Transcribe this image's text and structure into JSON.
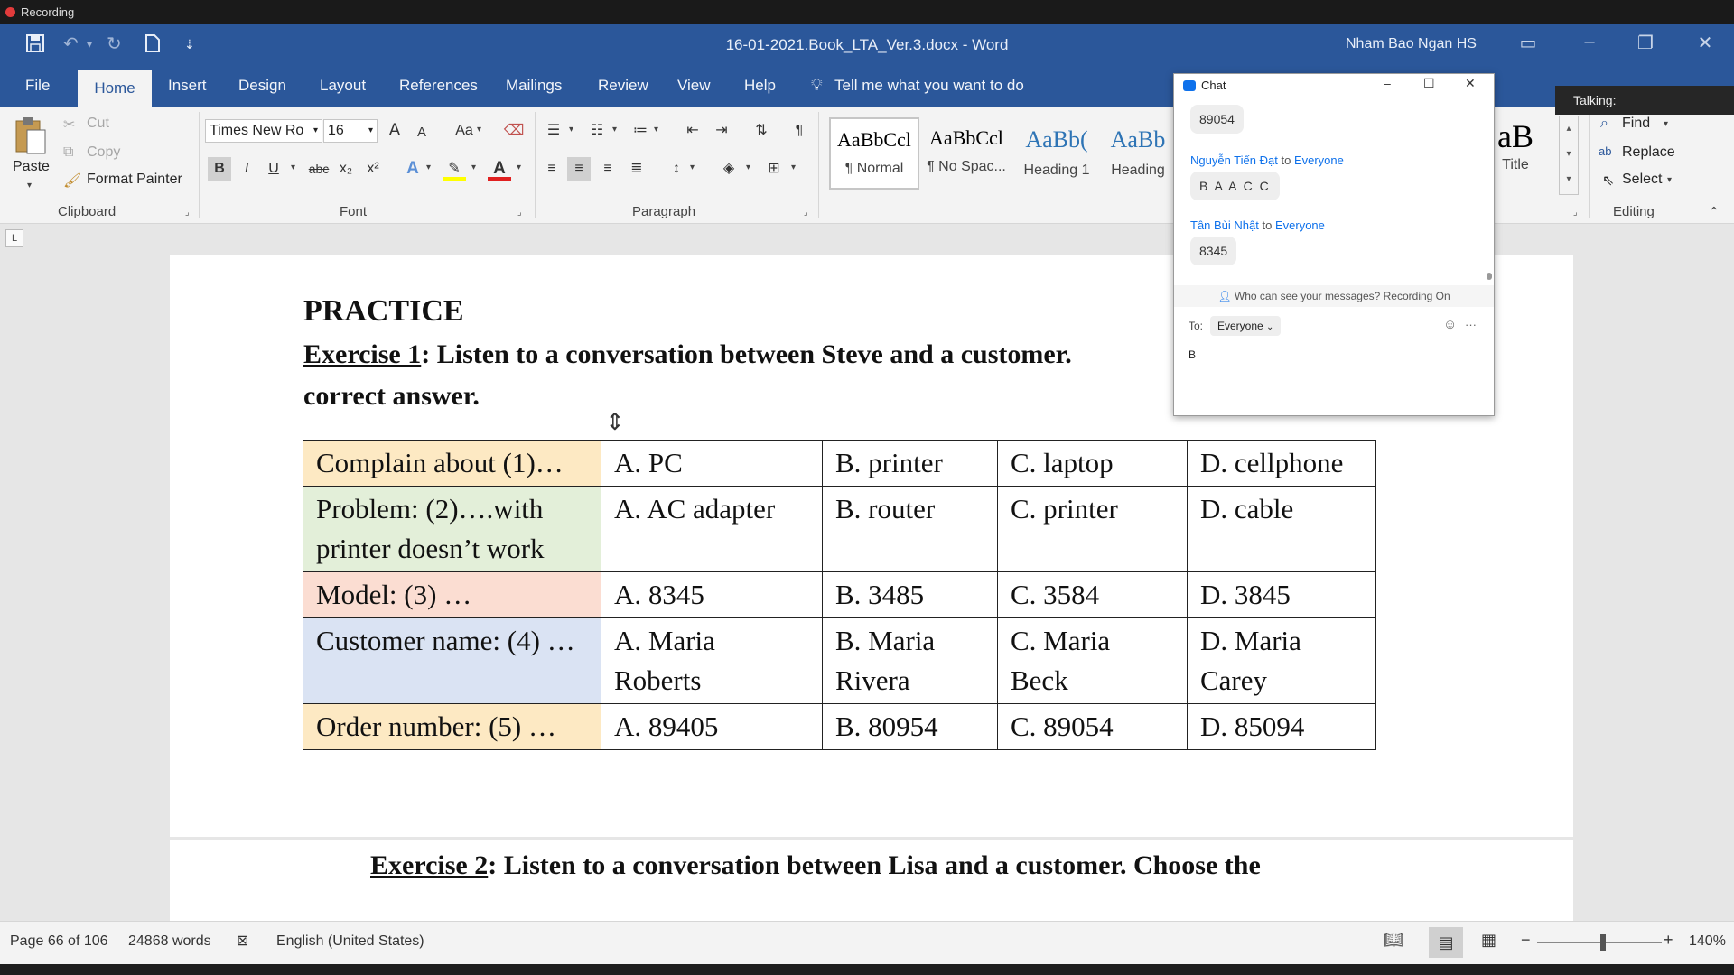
{
  "recording": {
    "label": "Recording"
  },
  "window": {
    "title": "16-01-2021.Book_LTA_Ver.3.docx  -  Word",
    "user": "Nham Bao Ngan HS"
  },
  "menu": {
    "tabs": [
      "File",
      "Home",
      "Insert",
      "Design",
      "Layout",
      "References",
      "Mailings",
      "Review",
      "View",
      "Help"
    ],
    "active": "Home",
    "tell_me": "Tell me what you want to do"
  },
  "ribbon": {
    "clipboard": {
      "paste": "Paste",
      "cut": "Cut",
      "copy": "Copy",
      "format_painter": "Format Painter",
      "group": "Clipboard"
    },
    "font": {
      "name": "Times New Ro",
      "size": "16",
      "group": "Font",
      "case_label": "Aa",
      "bold": "B",
      "italic": "I",
      "underline": "U",
      "strike": "abc",
      "sub": "x₂",
      "sup": "x²",
      "grow": "A",
      "shrink": "A",
      "font_color_letter": "A"
    },
    "paragraph": {
      "group": "Paragraph"
    },
    "styles": [
      {
        "preview": "AaBbCcl",
        "name": "¶ Normal"
      },
      {
        "preview": "AaBbCcl",
        "name": "¶ No Spac..."
      },
      {
        "preview": "AaBb(",
        "name": "Heading 1"
      },
      {
        "preview": "AaBb",
        "name": "Heading"
      },
      {
        "preview": "aB",
        "name": "Title"
      }
    ],
    "editing": {
      "find": "Find",
      "replace": "Replace",
      "select": "Select",
      "group": "Editing"
    }
  },
  "document": {
    "heading": "PRACTICE",
    "exercise1_label": "Exercise 1",
    "exercise1_text": ": Listen to a conversation between Steve and a customer.",
    "exercise1_line2": "correct answer.",
    "table": [
      {
        "q": "Complain about (1)…",
        "a": "A. PC",
        "b": "B. printer",
        "c": "C. laptop",
        "d": "D. cellphone",
        "color": "#fde9c3"
      },
      {
        "q": "Problem: (2)….with printer doesn’t work",
        "a": "A. AC adapter",
        "b": "B. router",
        "c": "C. printer",
        "d": "D. cable",
        "color": "#e3efd9"
      },
      {
        "q": "Model: (3) …",
        "a": "A. 8345",
        "b": "B. 3485",
        "c": "C. 3584",
        "d": "D. 3845",
        "color": "#fbddd2"
      },
      {
        "q": "Customer name: (4) …",
        "a": "A. Maria Roberts",
        "b": "B. Maria Rivera",
        "c": "C. Maria Beck",
        "d": "D. Maria Carey",
        "color": "#dae3f3"
      },
      {
        "q": "Order number: (5) …",
        "a": "A. 89405",
        "b": "B. 80954",
        "c": "C. 89054",
        "d": "D. 85094",
        "color": "#fde9c3"
      }
    ],
    "exercise2_label": "Exercise 2",
    "exercise2_text": ": Listen to a conversation between Lisa and a customer. Choose the"
  },
  "status": {
    "page": "Page 66 of 106",
    "words": "24868 words",
    "language": "English (United States)",
    "zoom": "140%",
    "zoom_minus": "−",
    "zoom_plus": "+"
  },
  "chat": {
    "title": "Chat",
    "messages": [
      {
        "sender": "",
        "to": "",
        "text": "89054"
      },
      {
        "sender": "Nguyễn Tiến Đạt",
        "to": "Everyone",
        "text": "B A A C C"
      },
      {
        "sender": "Tân Bùi Nhật",
        "to": "Everyone",
        "text": "8345"
      }
    ],
    "to_word": "to",
    "privacy": "Who can see your messages? Recording On",
    "to_label": "To:",
    "recipient": "Everyone",
    "draft": "B",
    "more": "···"
  },
  "talking": {
    "label": "Talking:"
  },
  "colors": {
    "word_blue": "#2b579a",
    "zoom_blue": "#0e71eb"
  }
}
